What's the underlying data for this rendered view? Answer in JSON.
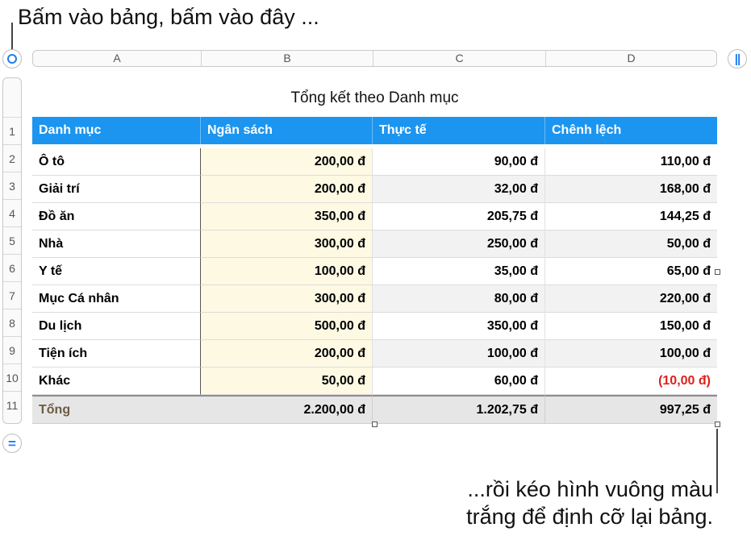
{
  "callouts": {
    "top": "Bấm vào bảng, bấm vào đây ...",
    "bottom_line1": "...rồi kéo hình vuông màu",
    "bottom_line2": "trắng để định cỡ lại bảng."
  },
  "column_headers": [
    "A",
    "B",
    "C",
    "D"
  ],
  "row_numbers": [
    "1",
    "2",
    "3",
    "4",
    "5",
    "6",
    "7",
    "8",
    "9",
    "10",
    "11"
  ],
  "table": {
    "title": "Tổng kết theo Danh mục",
    "headers": [
      "Danh mục",
      "Ngân sách",
      "Thực tế",
      "Chênh lệch"
    ],
    "rows": [
      [
        "Ô tô",
        "200,00 đ",
        "90,00 đ",
        "110,00 đ"
      ],
      [
        "Giải trí",
        "200,00 đ",
        "32,00 đ",
        "168,00 đ"
      ],
      [
        "Đồ ăn",
        "350,00 đ",
        "205,75 đ",
        "144,25 đ"
      ],
      [
        "Nhà",
        "300,00 đ",
        "250,00 đ",
        "50,00 đ"
      ],
      [
        "Y tế",
        "100,00 đ",
        "35,00 đ",
        "65,00 đ"
      ],
      [
        "Mục Cá nhân",
        "300,00 đ",
        "80,00 đ",
        "220,00 đ"
      ],
      [
        "Du lịch",
        "500,00 đ",
        "350,00 đ",
        "150,00 đ"
      ],
      [
        "Tiện ích",
        "200,00 đ",
        "100,00 đ",
        "100,00 đ"
      ],
      [
        "Khác",
        "50,00 đ",
        "60,00 đ",
        "(10,00 đ)"
      ]
    ],
    "total": [
      "Tổng",
      "2.200,00 đ",
      "1.202,75 đ",
      "997,25 đ"
    ]
  },
  "icons": {
    "select_table": "circle-select-icon",
    "column_handle": "pause-handle-icon",
    "row_handle": "equals-handle-icon"
  },
  "colors": {
    "header_blue": "#1c95f0",
    "budget_column": "#fdf9e3",
    "negative_red": "#e0201b",
    "total_row": "#e6e6e6",
    "accent_blue": "#1e7cf2"
  }
}
